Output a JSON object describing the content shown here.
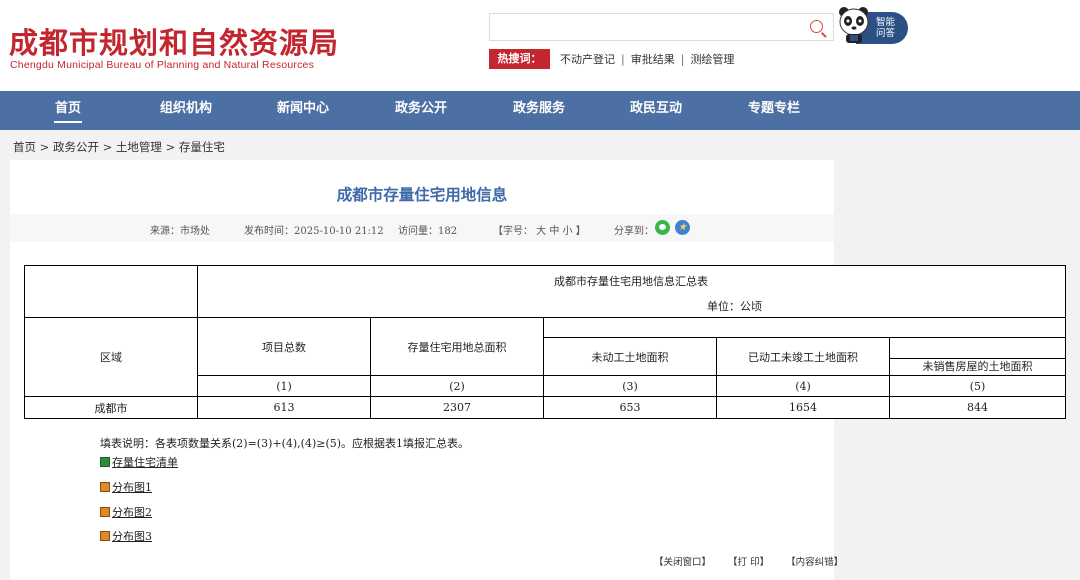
{
  "header": {
    "logo_cn": "成都市规划和自然资源局",
    "logo_en": "Chengdu Municipal Bureau of Planning and Natural Resources",
    "search_placeholder": "",
    "hot_label": "热搜词：",
    "hot_links": [
      "不动产登记",
      "审批结果",
      "测绘管理"
    ],
    "hot_sep": "|",
    "assistant_line1": "智能",
    "assistant_line2": "问答"
  },
  "nav": {
    "items": [
      "首页",
      "组织机构",
      "新闻中心",
      "政务公开",
      "政务服务",
      "政民互动",
      "专题专栏"
    ],
    "active": "首页"
  },
  "breadcrumb": [
    "首页",
    "政务公开",
    "土地管理",
    "存量住宅"
  ],
  "breadcrumb_sep": ">",
  "article": {
    "title": "成都市存量住宅用地信息",
    "source": "来源：市场处",
    "published": "发布时间：2025-10-10 21:12",
    "visits": "访问量：182",
    "font_size": "【字号： 大 中 小 】",
    "share": "分享到："
  },
  "table": {
    "caption": "成都市存量住宅用地信息汇总表",
    "unit": "单位：公顷",
    "headers": {
      "region": "区域",
      "projects": "项目总数",
      "total_area": "存量住宅用地总面积",
      "unstarted": "未动工土地面积",
      "started_unfinished": "已动工未竣工土地面积",
      "unsold": "未销售房屋的土地面积"
    },
    "indices": [
      "(1)",
      "(2)",
      "(3)",
      "(4)",
      "(5)"
    ],
    "rows": [
      {
        "region": "成都市",
        "values": [
          "613",
          "2307",
          "653",
          "1654",
          "844"
        ]
      }
    ]
  },
  "note": "填表说明：各表项数量关系(2)=(3)+(4),(4)≥(5)。应根据表1填报汇总表。",
  "attachments": [
    "存量住宅清单",
    "分布图1",
    "分布图2",
    "分布图3"
  ],
  "footer_links": [
    "【关闭窗口】",
    "【打 印】",
    "【内容纠错】"
  ],
  "colors": {
    "brand_red": "#c3262f",
    "nav_blue": "#4c6fa4",
    "title_blue": "#3e6aa8"
  }
}
